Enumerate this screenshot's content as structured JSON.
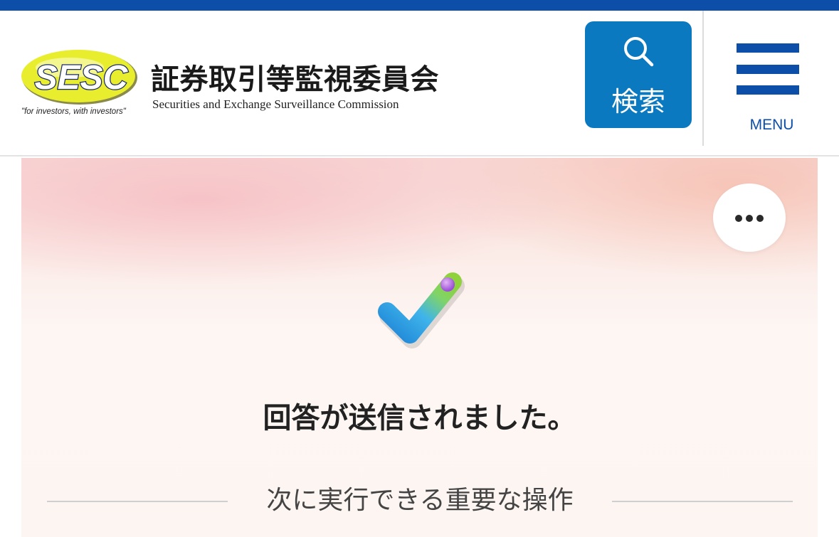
{
  "header": {
    "logo_text": "SESC",
    "tagline": "\"for investors, with investors\"",
    "org_name_ja": "証券取引等監視委員会",
    "org_name_en": "Securities and Exchange Surveillance Commission",
    "search_label": "検索",
    "menu_label": "MENU"
  },
  "main": {
    "result_title": "回答が送信されました。",
    "next_actions_heading": "次に実行できる重要な操作"
  },
  "colors": {
    "brand_blue": "#0d4fa8",
    "search_blue": "#0a79c0",
    "logo_yellow": "#e6ec2a"
  },
  "icons": {
    "search": "search-icon",
    "menu": "hamburger-menu-icon",
    "more": "more-options-icon",
    "success": "checkmark-icon"
  }
}
